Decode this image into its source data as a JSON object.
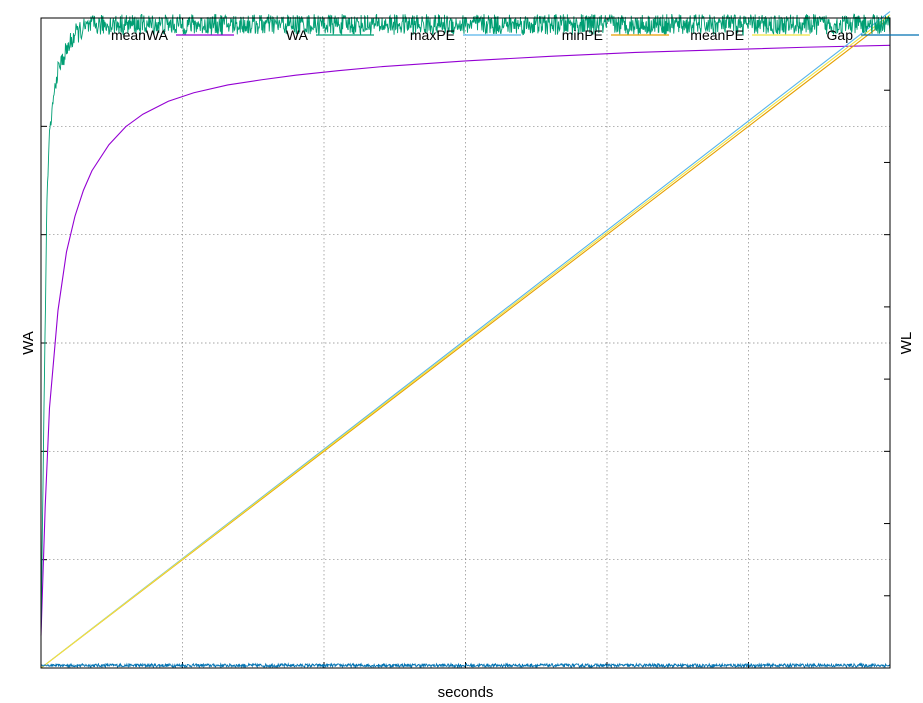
{
  "chart_data": {
    "type": "line",
    "title": "",
    "xlabel": "seconds",
    "ylabel": "WA",
    "y2label": "WL",
    "grid": true,
    "legend_position": "top",
    "x_range": [
      0,
      100
    ],
    "y_range": [
      0,
      100
    ],
    "y2_range": [
      0,
      100
    ],
    "x_tick_count": 6,
    "y_tick_count": 6,
    "y2_tick_count": 9,
    "series": [
      {
        "name": "meanWA",
        "axis": "y",
        "color": "#9400d3",
        "x": [
          0,
          0.5,
          1,
          2,
          3,
          4,
          5,
          6,
          8,
          10,
          12,
          15,
          18,
          22,
          26,
          30,
          35,
          40,
          50,
          60,
          70,
          80,
          90,
          100
        ],
        "y": [
          5,
          25,
          40,
          55,
          64,
          69.5,
          73.5,
          76.5,
          80.5,
          83.3,
          85.2,
          87.2,
          88.5,
          89.7,
          90.5,
          91.2,
          91.9,
          92.5,
          93.4,
          94.1,
          94.7,
          95.1,
          95.5,
          95.8
        ]
      },
      {
        "name": "WA",
        "axis": "y",
        "color": "#009e73",
        "noise": 1.6,
        "x": [
          0,
          0.3,
          0.7,
          1,
          1.5,
          2,
          3,
          4,
          5,
          6,
          8,
          10,
          15,
          20,
          30,
          40,
          50,
          60,
          70,
          80,
          90,
          100
        ],
        "y": [
          5,
          35,
          72,
          82,
          88,
          92,
          95,
          97.5,
          98.3,
          98.8,
          99,
          99,
          99,
          99,
          99,
          99,
          99,
          99,
          99,
          99,
          99,
          99
        ]
      },
      {
        "name": "maxPE",
        "axis": "y2",
        "color": "#56b4e9",
        "x": [
          0,
          100
        ],
        "y": [
          0,
          101
        ]
      },
      {
        "name": "minPE",
        "axis": "y2",
        "color": "#e69f00",
        "x": [
          0,
          100
        ],
        "y": [
          0,
          100
        ]
      },
      {
        "name": "meanPE",
        "axis": "y2",
        "color": "#f0e442",
        "x": [
          0,
          100
        ],
        "y": [
          0,
          100.5
        ]
      },
      {
        "name": "Gap",
        "axis": "y2",
        "color": "#0072b2",
        "noise": 0.25,
        "x": [
          0,
          100
        ],
        "y": [
          0.4,
          0.4
        ]
      }
    ]
  }
}
